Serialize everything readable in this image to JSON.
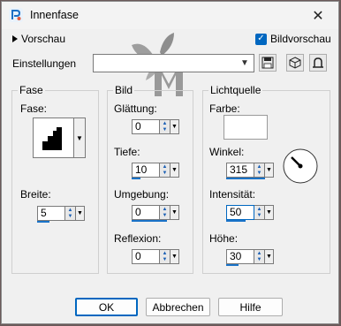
{
  "window": {
    "title": "Innenfase",
    "close_label": "✕"
  },
  "preview": {
    "toggle_label": "Vorschau",
    "checkbox_label": "Bildvorschau",
    "checked": true
  },
  "settings": {
    "label": "Einstellungen",
    "value": ""
  },
  "fase": {
    "group_label": "Fase",
    "shape_label": "Fase:",
    "width_label": "Breite:",
    "width_value": "5"
  },
  "bild": {
    "group_label": "Bild",
    "smoothing_label": "Glättung:",
    "smoothing_value": "0",
    "depth_label": "Tiefe:",
    "depth_value": "10",
    "ambient_label": "Umgebung:",
    "ambient_value": "0",
    "reflection_label": "Reflexion:",
    "reflection_value": "0"
  },
  "light": {
    "group_label": "Lichtquelle",
    "color_label": "Farbe:",
    "color_value": "#ffffff",
    "angle_label": "Winkel:",
    "angle_value": "315",
    "intensity_label": "Intensität:",
    "intensity_value": "50",
    "height_label": "Höhe:",
    "height_value": "30"
  },
  "buttons": {
    "ok": "OK",
    "cancel": "Abbrechen",
    "help": "Hilfe"
  },
  "colors": {
    "accent": "#0067c0",
    "watermark": "#8a8a8a"
  }
}
